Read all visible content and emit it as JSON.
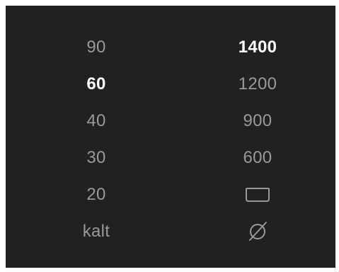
{
  "temperature": {
    "options": [
      {
        "label": "90",
        "selected": false
      },
      {
        "label": "60",
        "selected": true
      },
      {
        "label": "40",
        "selected": false
      },
      {
        "label": "30",
        "selected": false
      },
      {
        "label": "20",
        "selected": false
      },
      {
        "label": "kalt",
        "selected": false
      }
    ]
  },
  "spin": {
    "options": [
      {
        "label": "1400",
        "selected": true
      },
      {
        "label": "1200",
        "selected": false
      },
      {
        "label": "900",
        "selected": false
      },
      {
        "label": "600",
        "selected": false
      },
      {
        "label": "",
        "icon": "rinse-hold-tub-icon",
        "selected": false
      },
      {
        "label": "",
        "icon": "no-spin-icon",
        "selected": false
      }
    ]
  },
  "colors": {
    "background": "#232021",
    "inactive_text": "#9a9899",
    "active_text": "#ffffff"
  }
}
